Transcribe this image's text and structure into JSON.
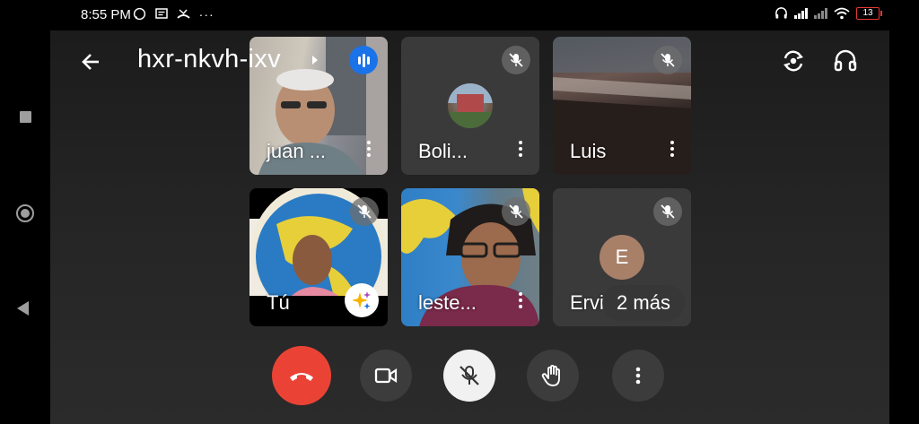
{
  "status_bar": {
    "time": "8:55 PM",
    "left_icons": [
      "whatsapp-icon",
      "message-icon",
      "missed-call-icon",
      "more-notifications-icon"
    ],
    "battery": "13"
  },
  "nav_bar": {
    "buttons": [
      "recent-apps",
      "home",
      "back"
    ]
  },
  "header": {
    "meeting_code": "hxr-nkvh-ixv",
    "icons": [
      "back-arrow-icon",
      "speaking-indicator-icon",
      "switch-camera-icon",
      "audio-output-icon"
    ]
  },
  "tiles": [
    {
      "name": "juan ...",
      "muted": false,
      "type": "video"
    },
    {
      "name": "Boli...",
      "muted": true,
      "type": "avatar-photo"
    },
    {
      "name": "Luis",
      "muted": true,
      "type": "video"
    },
    {
      "name": "Tú",
      "muted": true,
      "type": "self-video"
    },
    {
      "name": "leste...",
      "muted": true,
      "type": "video"
    },
    {
      "name": "Ervi",
      "muted": true,
      "type": "avatar-letter",
      "initial": "E",
      "more_label": "2 más"
    }
  ],
  "controls": [
    {
      "name": "end-call",
      "color": "#ea4335"
    },
    {
      "name": "camera-toggle"
    },
    {
      "name": "microphone-toggle",
      "state": "muted"
    },
    {
      "name": "raise-hand"
    },
    {
      "name": "more-options"
    }
  ],
  "colors": {
    "end_call": "#ea4335",
    "speaking_indicator": "#1a73e8",
    "background": "#202124"
  }
}
